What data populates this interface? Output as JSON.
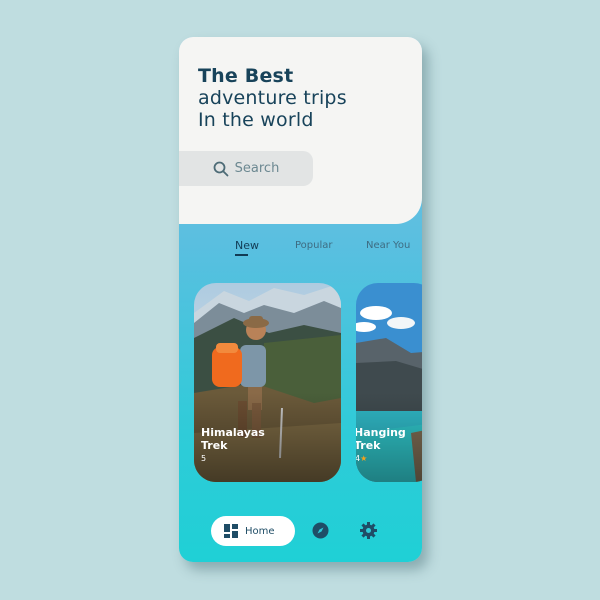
{
  "header": {
    "line1": "The Best",
    "line2": "adventure trips",
    "line3": "In the world"
  },
  "search": {
    "label": "Search",
    "icon": "search-icon"
  },
  "tabs": [
    {
      "label": "New",
      "active": true
    },
    {
      "label": "Popular",
      "active": false
    },
    {
      "label": "Near You",
      "active": false
    }
  ],
  "cards": [
    {
      "title_line1": "Himalayas",
      "title_line2": "Trek",
      "rating": "5"
    },
    {
      "title_line1": "Hanging",
      "title_line2": "Trek",
      "rating": "4"
    }
  ],
  "nav": {
    "home_label": "Home",
    "home_icon": "dashboard-icon",
    "explore_icon": "compass-icon",
    "settings_icon": "gear-icon"
  },
  "colors": {
    "primary_text": "#18435a",
    "star": "#f4a21b",
    "background": "#bfdde0"
  }
}
